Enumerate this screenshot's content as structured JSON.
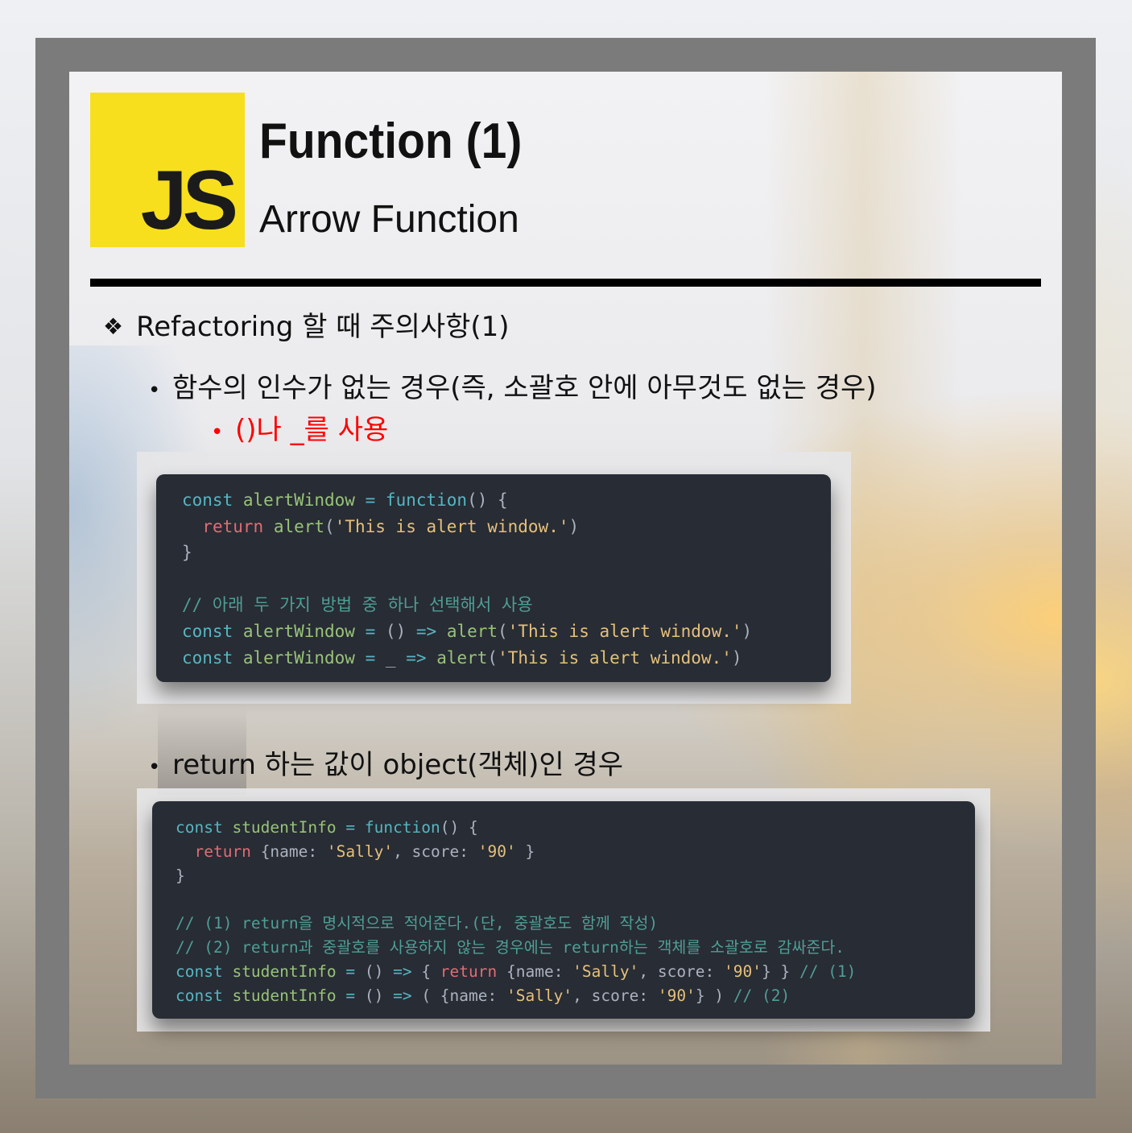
{
  "logo": {
    "text": "JS"
  },
  "header": {
    "title": "Function (1)",
    "subtitle": "Arrow Function"
  },
  "section": {
    "heading": "Refactoring 할 때 주의사항(1)"
  },
  "bullets": {
    "no_args": "함수의 인수가 없는 경우(즉, 소괄호 안에 아무것도 없는 경우)",
    "no_args_tip": "()나 _를 사용",
    "return_object": "return 하는 값이 object(객체)인 경우"
  },
  "code1": {
    "kw_const": "const",
    "name": "alertWindow",
    "eq": "=",
    "kw_function": "function",
    "paren": "() {",
    "kw_return": "return",
    "alert": "alert",
    "str": "'This is alert window.'",
    "close": "}",
    "comment": "// 아래 두 가지 방법 중 하나 선택해서 사용",
    "arrow": "=>",
    "empty_parens": "()",
    "underscore": "_"
  },
  "code2": {
    "kw_const": "const",
    "name": "studentInfo",
    "eq": "=",
    "kw_function": "function",
    "kw_return": "return",
    "comment1": "// (1) return을 명시적으로 적어준다.(단, 중괄호도 함께 작성)",
    "comment2": "// (2) return과 중괄호를 사용하지 않는 경우에는 return하는 객체를 소괄호로 감싸준다.",
    "str_sally": "'Sally'",
    "str_90": "'90'",
    "tag1": "// (1)",
    "tag2": "// (2)"
  },
  "colors": {
    "accent": "#f7df1e",
    "frame": "#7b7b7b",
    "code_bg": "#282c34",
    "highlight_red": "#ff0000"
  },
  "icons": {
    "heading_marker": "four-diamond-icon",
    "bullet": "bullet-dot-icon"
  }
}
